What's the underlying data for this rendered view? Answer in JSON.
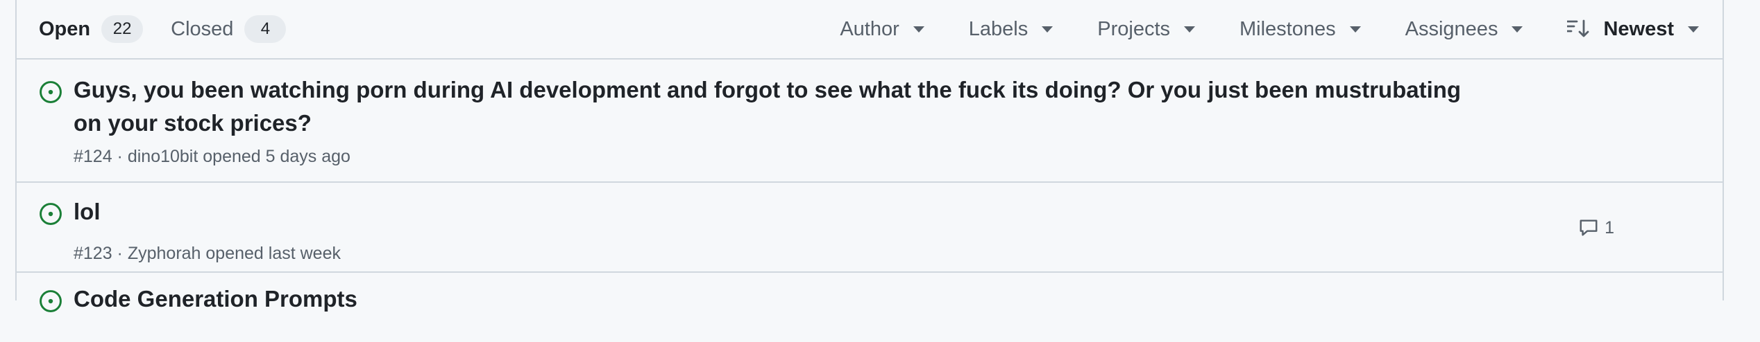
{
  "toolbar": {
    "open_label": "Open",
    "open_count": "22",
    "closed_label": "Closed",
    "closed_count": "4",
    "filters": {
      "author": "Author",
      "labels": "Labels",
      "projects": "Projects",
      "milestones": "Milestones",
      "assignees": "Assignees",
      "sort": "Newest"
    }
  },
  "issues": [
    {
      "title": "Guys, you been watching porn during AI development and forgot to see what the fuck its doing? Or you just been mustrubating on your stock prices?",
      "meta": "#124 · dino10bit opened 5 days ago",
      "comments": ""
    },
    {
      "title": "lol",
      "meta": "#123 · Zyphorah opened last week",
      "comments": "1"
    },
    {
      "title": "Code Generation Prompts",
      "meta": "",
      "comments": ""
    }
  ],
  "icons": {
    "open_issue": "issue-opened-icon",
    "comment": "comment-icon",
    "sort": "sort-desc-icon",
    "caret": "triangle-down-icon"
  },
  "colors": {
    "open_green": "#1a7f37",
    "border": "#d0d7de",
    "muted": "#57606a",
    "text": "#1f2328",
    "background": "#f6f8fa"
  }
}
